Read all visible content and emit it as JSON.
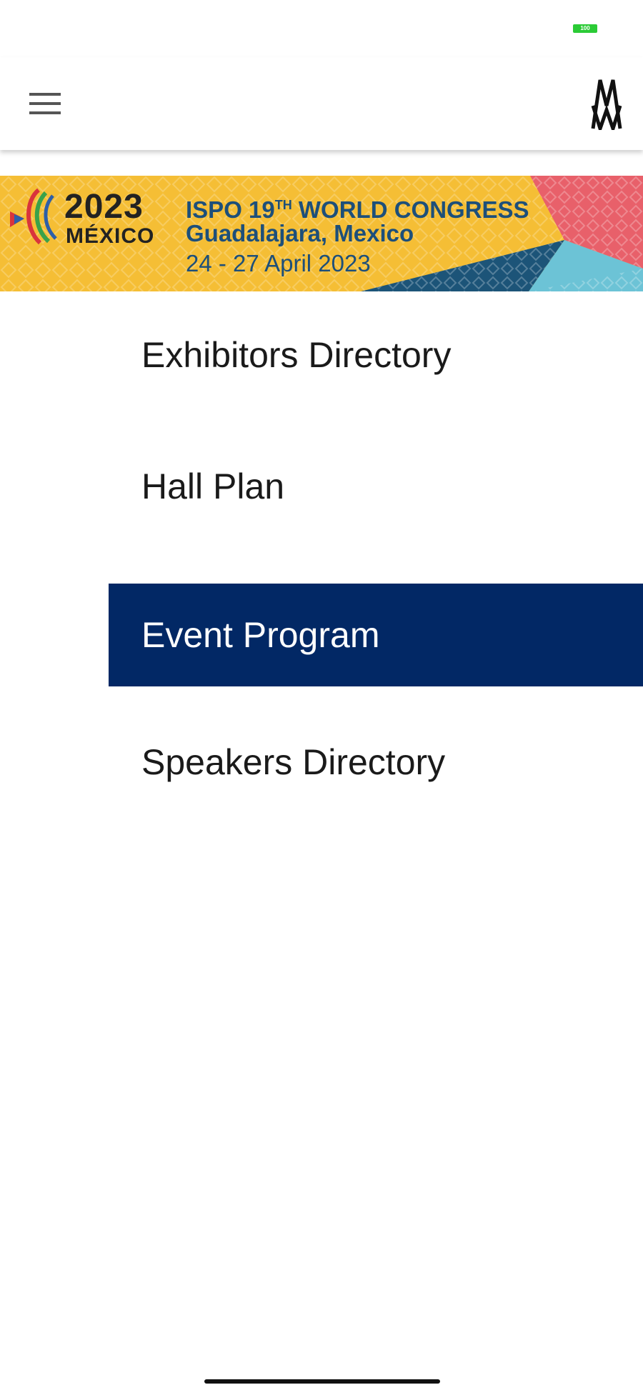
{
  "status_bar": {
    "battery_level_percent": 100,
    "battery_color": "#2bcb36",
    "battery_label": "100"
  },
  "app_bar": {
    "menu_icon": "hamburger-menu-icon",
    "logo_icon": "messe-logo-icon"
  },
  "banner": {
    "logo_year": "2023",
    "logo_country": "MÉXICO",
    "title_prefix": "ISPO 19",
    "title_superscript": "TH",
    "title_suffix": " WORLD CONGRESS",
    "city": "Guadalajara, Mexico",
    "dates": "24 - 27 April 2023",
    "background_color": "#f5be35",
    "text_color": "#1d4f7a"
  },
  "menu": {
    "items": [
      {
        "label": "Exhibitors Directory",
        "active": false
      },
      {
        "label": "Hall Plan",
        "active": false
      },
      {
        "label": "Event Program",
        "active": true
      },
      {
        "label": "Speakers Directory",
        "active": false
      }
    ],
    "active_color": "#022865"
  }
}
